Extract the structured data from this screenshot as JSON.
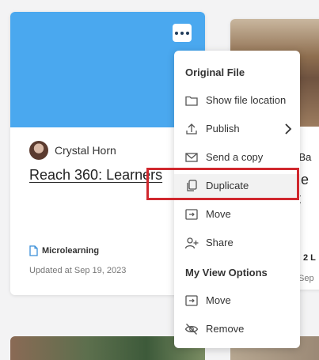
{
  "card": {
    "author_name": "Crystal Horn",
    "title": "Reach 360: Learners",
    "type_label": "Microlearning",
    "updated": "Updated at Sep 19, 2023",
    "cover_color": "#4aa8ef",
    "more_icon": "more-horizontal-icon"
  },
  "card2": {
    "frag_top": "l Ba",
    "frag_title1": "ze",
    "frag_title2": "t",
    "frag_type": "2 L",
    "frag_date": "Sep"
  },
  "menu": {
    "section_original": "Original File",
    "items_original": [
      {
        "label": "Show file location",
        "icon": "folder-icon"
      },
      {
        "label": "Publish",
        "icon": "upload-icon"
      },
      {
        "label": "Send a copy",
        "icon": "envelope-icon"
      },
      {
        "label": "Duplicate",
        "icon": "copy-icon"
      },
      {
        "label": "Move",
        "icon": "move-to-folder-icon"
      },
      {
        "label": "Share",
        "icon": "add-user-icon"
      }
    ],
    "section_view": "My View Options",
    "items_view": [
      {
        "label": "Move",
        "icon": "move-to-folder-icon"
      },
      {
        "label": "Remove",
        "icon": "eye-off-icon"
      }
    ]
  },
  "highlight_color": "#d0282e"
}
